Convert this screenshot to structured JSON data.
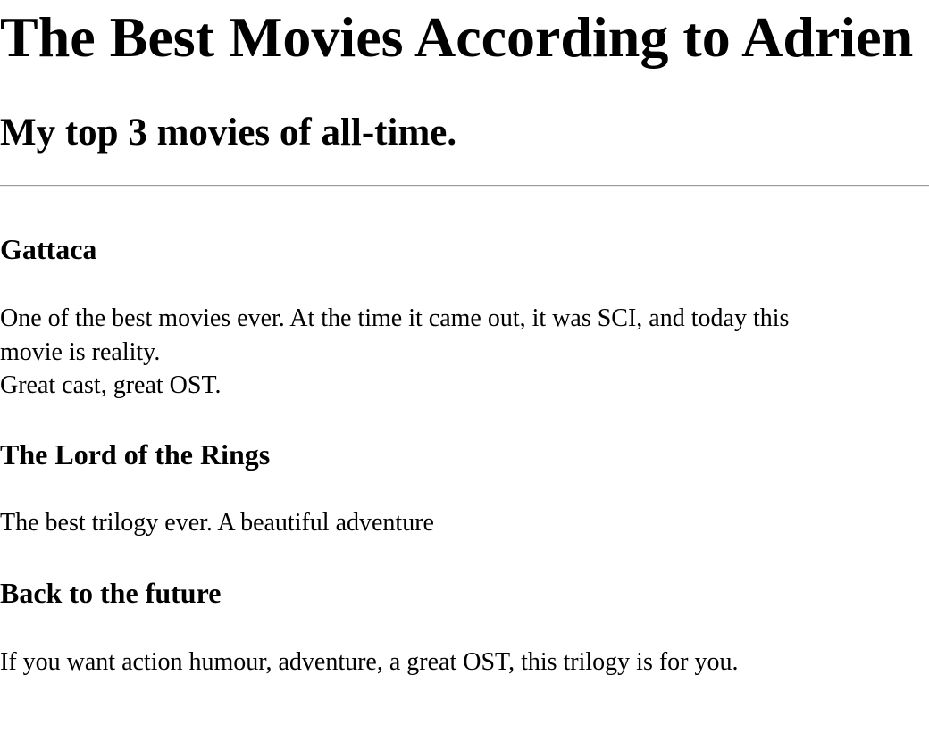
{
  "page": {
    "title": "The Best Movies According to Adrien",
    "subtitle": "My top 3 movies of all-time."
  },
  "movies": [
    {
      "title": "Gattaca",
      "description_lines": [
        "One of the best movies ever. At the time it came out, it was SCI, and today this",
        "movie is reality.",
        "Great cast, great OST."
      ]
    },
    {
      "title": "The Lord of the Rings",
      "description_lines": [
        "The best trilogy ever. A beautiful adventure"
      ]
    },
    {
      "title": "Back to the future",
      "description_lines": [
        "If you want action humour, adventure, a great OST, this trilogy is for you."
      ]
    }
  ]
}
